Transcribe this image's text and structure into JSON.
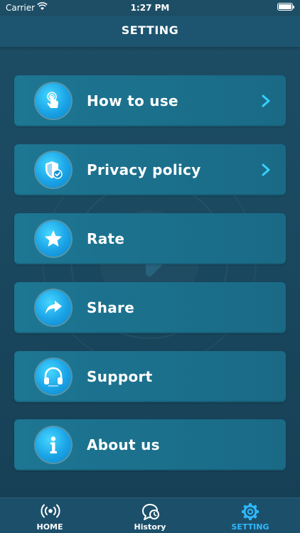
{
  "status_bar": {
    "carrier": "Carrier",
    "time": "1:27 PM"
  },
  "header": {
    "title": "SETTING"
  },
  "menu": {
    "items": [
      {
        "label": "How to use",
        "icon": "touch-hand-icon",
        "chevron": true
      },
      {
        "label": "Privacy policy",
        "icon": "shield-check-icon",
        "chevron": true
      },
      {
        "label": "Rate",
        "icon": "star-icon",
        "chevron": false
      },
      {
        "label": "Share",
        "icon": "share-arrow-icon",
        "chevron": false
      },
      {
        "label": "Support",
        "icon": "headphones-icon",
        "chevron": false
      },
      {
        "label": "About us",
        "icon": "info-icon",
        "chevron": false
      }
    ]
  },
  "tab_bar": {
    "tabs": [
      {
        "label": "HOME",
        "icon": "broadcast-icon",
        "active": false
      },
      {
        "label": "History",
        "icon": "history-icon",
        "active": false
      },
      {
        "label": "SETTING",
        "icon": "gear-icon",
        "active": true
      }
    ]
  },
  "colors": {
    "accent": "#2fb8ff",
    "chevron": "#34d0ff",
    "card": "#1d7692",
    "background": "#1a4960"
  }
}
